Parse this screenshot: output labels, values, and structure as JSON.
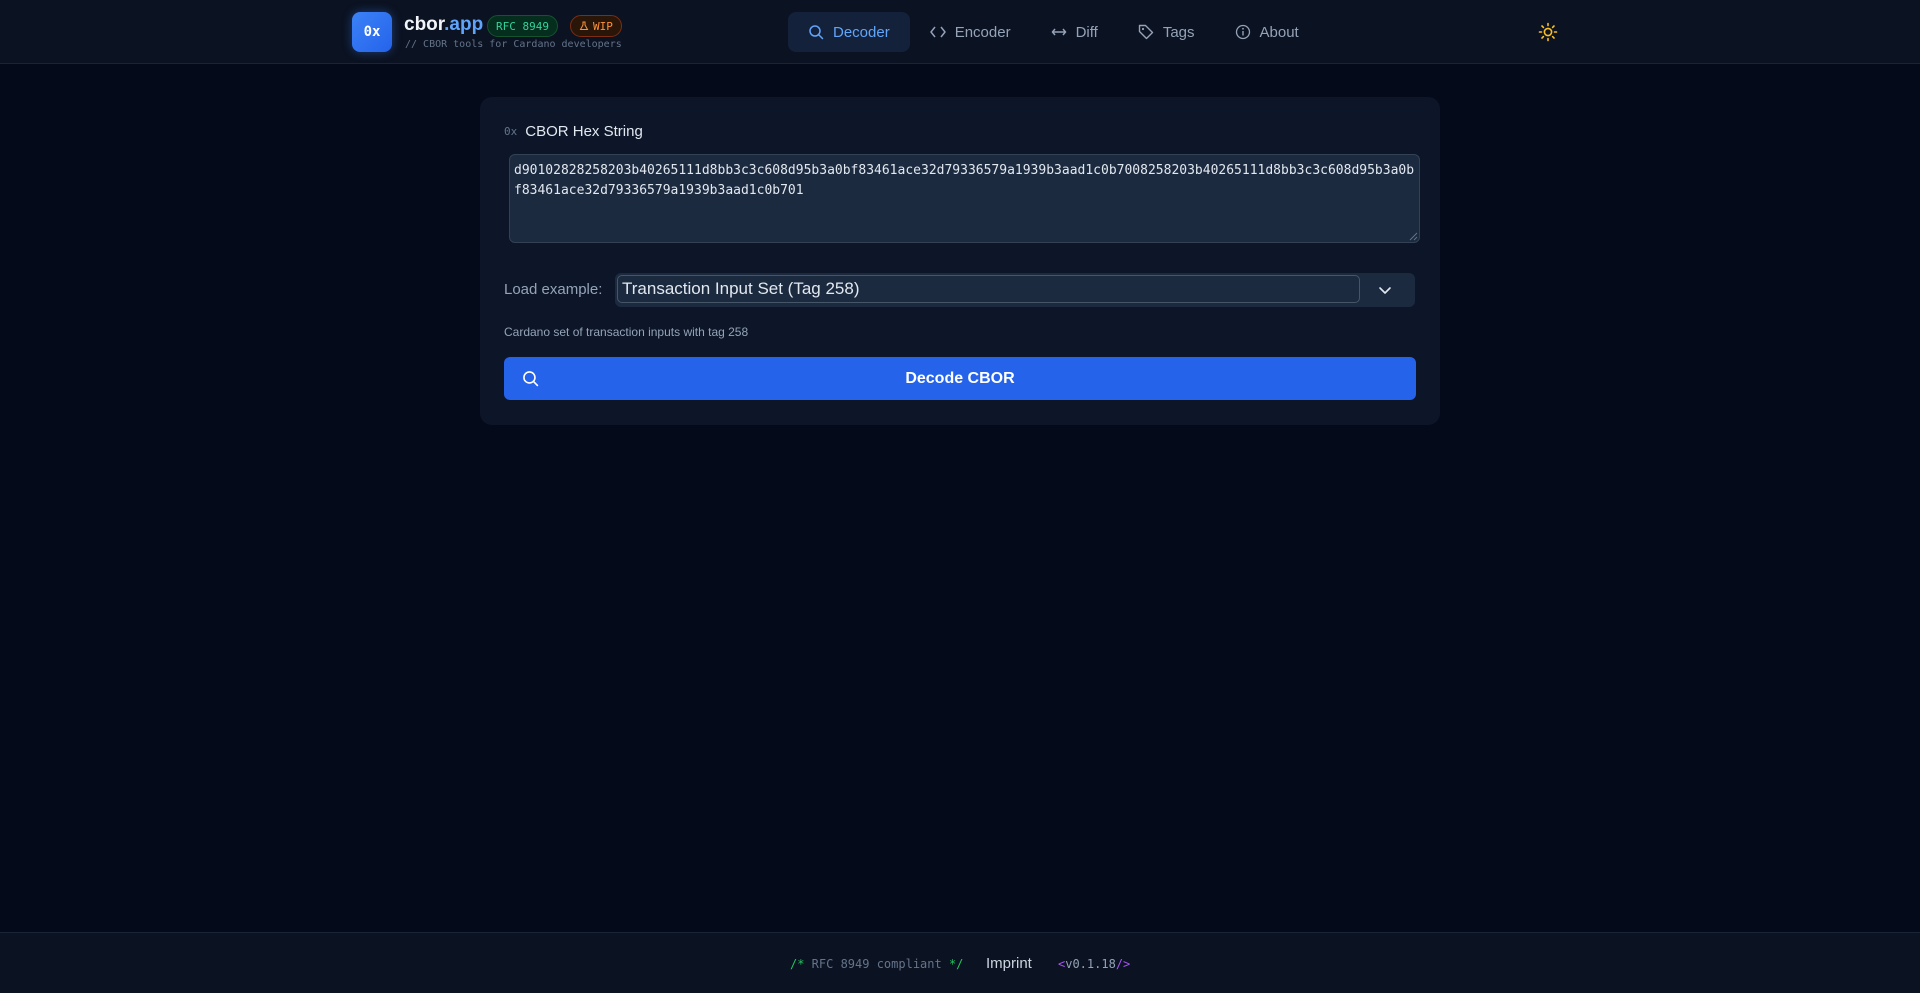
{
  "header": {
    "logo_text": "0x",
    "brand_name": "cbor",
    "brand_tld": ".app",
    "badge_rfc": "RFC 8949",
    "badge_wip": "WIP",
    "tagline": "// CBOR tools for Cardano developers",
    "nav": [
      {
        "label": "Decoder",
        "icon": "search-icon",
        "active": true
      },
      {
        "label": "Encoder",
        "icon": "code-icon",
        "active": false
      },
      {
        "label": "Diff",
        "icon": "arrows-horizontal-icon",
        "active": false
      },
      {
        "label": "Tags",
        "icon": "tag-icon",
        "active": false
      },
      {
        "label": "About",
        "icon": "info-icon",
        "active": false
      }
    ],
    "theme_icon": "sun-icon"
  },
  "panel": {
    "label_prefix": "0x",
    "label": "CBOR Hex String",
    "hex_value": "d90102828258203b40265111d8bb3c3c608d95b3a0bf83461ace32d79336579a1939b3aad1c0b7008258203b40265111d8bb3c3c608d95b3a0bf83461ace32d79336579a1939b3aad1c0b701",
    "load_label": "Load example:",
    "selected_example": "Transaction Input Set (Tag 258)",
    "description": "Cardano set of transaction inputs with tag 258",
    "decode_label": "Decode CBOR"
  },
  "footer": {
    "rfc_open": "/*",
    "rfc_text": " RFC 8949 compliant ",
    "rfc_close": "*/",
    "imprint": "Imprint",
    "version_open": "<",
    "version": "v0.1.18",
    "version_close": "/>"
  },
  "colors": {
    "background": "#050a1a",
    "accent": "#2563eb",
    "accent_light": "#60a5fa",
    "rfc_green": "#34d399",
    "wip_orange": "#fb923c",
    "sun_yellow": "#fbbf24"
  }
}
